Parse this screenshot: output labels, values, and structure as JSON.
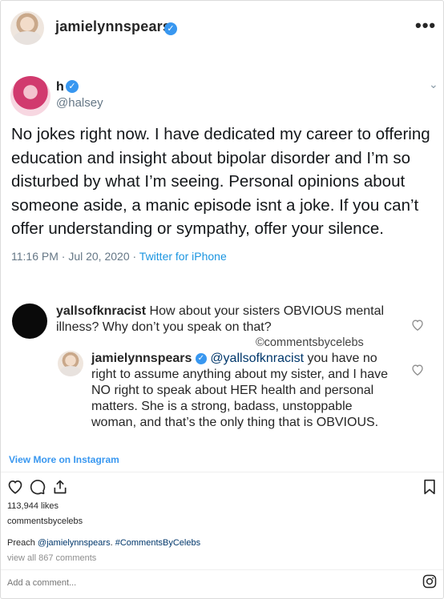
{
  "header": {
    "username": "jamielynnspears",
    "verified_mark": "✓",
    "more": "•••"
  },
  "tweet": {
    "name": "h",
    "verified_mark": "✓",
    "handle": "@halsey",
    "chevron": "⌄",
    "text": "No jokes right now. I have dedicated my career to offering education and insight about bipolar disorder and I’m so disturbed by what I’m seeing. Personal opinions about someone aside, a manic episode isnt a joke. If you can’t offer understanding or sympathy, offer your silence.",
    "time": "11:16 PM · Jul 20, 2020 · ",
    "source": "Twitter for iPhone"
  },
  "comments": {
    "first": {
      "username": "yallsofknracist",
      "text": " How about your sisters OBVIOUS mental illness? Why don’t you speak on that?"
    },
    "watermark": "©commentsbycelebs",
    "reply": {
      "username": "jamielynnspears",
      "verified_mark": "✓",
      "mention": "@yallsofknracist",
      "text": " you have no right to assume anything about my sister, and I have NO right to speak about HER health and personal matters. She is a strong, badass, unstoppable woman, and that’s the only thing that is OBVIOUS."
    }
  },
  "embed": {
    "view_more": "View More on Instagram"
  },
  "footer": {
    "likes": "113,944 likes",
    "caption_user": "commentsbycelebs",
    "caption_text": "Preach ",
    "caption_mention": "@jamielynnspears",
    "caption_sep": ". ",
    "caption_hashtag": "#CommentsByCelebs",
    "view_all": "view all 867 comments",
    "add_comment_placeholder": "Add a comment..."
  },
  "icons": [
    "heart-icon",
    "comment-icon",
    "share-icon",
    "bookmark-icon",
    "instagram-icon",
    "verified-icon",
    "more-icon",
    "chevron-down-icon"
  ]
}
